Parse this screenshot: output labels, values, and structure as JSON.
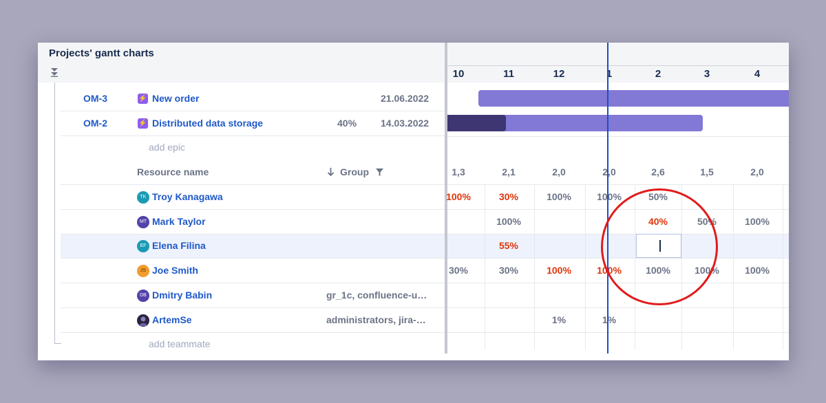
{
  "panel": {
    "title": "Projects' gantt charts"
  },
  "epics": [
    {
      "key": "OM-3",
      "name": "New order",
      "progress": "",
      "date": "21.06.2022"
    },
    {
      "key": "OM-2",
      "name": "Distributed data storage",
      "progress": "40%",
      "date": "14.03.2022"
    }
  ],
  "add_epic_label": "add epic",
  "resource_header": {
    "name_label": "Resource name",
    "group_label": "Group"
  },
  "resources": [
    {
      "name": "Troy Kanagawa",
      "initials": "TK",
      "color": "#1a9bb3",
      "group": ""
    },
    {
      "name": "Mark Taylor",
      "initials": "MT",
      "color": "#5243aa",
      "group": ""
    },
    {
      "name": "Elena Filina",
      "initials": "EF",
      "color": "#1a9bb3",
      "group": ""
    },
    {
      "name": "Joe Smith",
      "initials": "JS",
      "color": "#f29b2e",
      "group": ""
    },
    {
      "name": "Dmitry Babin",
      "initials": "DB",
      "color": "#5243aa",
      "group": "gr_1c, confluence-u…"
    },
    {
      "name": "ArtemSe",
      "initials": "",
      "color": "#2b2440",
      "group": "administrators, jira-…"
    }
  ],
  "add_teammate_label": "add teammate",
  "timeline": {
    "days": [
      "10",
      "11",
      "12",
      "1",
      "2",
      "3",
      "4"
    ],
    "capacity": [
      "1,3",
      "2,1",
      "2,0",
      "2,0",
      "2,6",
      "1,5",
      "2,0"
    ],
    "bars": [
      {
        "task": "OM-3",
        "progress": 0
      },
      {
        "task": "OM-2",
        "progress": 0.23
      }
    ],
    "loads": [
      [
        "100%",
        "30%",
        "100%",
        "100%",
        "50%",
        "",
        ""
      ],
      [
        "",
        "100%",
        "",
        "",
        "40%",
        "50%",
        "100%"
      ],
      [
        "",
        "55%",
        "",
        "",
        "",
        "",
        ""
      ],
      [
        "30%",
        "30%",
        "100%",
        "100%",
        "100%",
        "100%",
        "100%"
      ],
      [
        "",
        "",
        "",
        "",
        "",
        "",
        ""
      ],
      [
        "",
        "",
        "1%",
        "1%",
        "",
        "",
        ""
      ]
    ],
    "overloaded": [
      [
        true,
        true,
        false,
        false,
        false,
        false,
        false
      ],
      [
        false,
        false,
        false,
        false,
        true,
        false,
        false
      ],
      [
        false,
        true,
        false,
        false,
        false,
        false,
        false
      ],
      [
        false,
        false,
        true,
        true,
        false,
        false,
        false
      ],
      [
        false,
        false,
        false,
        false,
        false,
        false,
        false
      ],
      [
        false,
        false,
        false,
        false,
        false,
        false,
        false
      ]
    ]
  },
  "colors": {
    "accent": "#1f59c9",
    "overload": "#de350b",
    "bar": "#8278d6",
    "bar_progress": "#3e3673",
    "today_line": "#1d4fc4",
    "annotation_ring": "#e01b1b"
  }
}
